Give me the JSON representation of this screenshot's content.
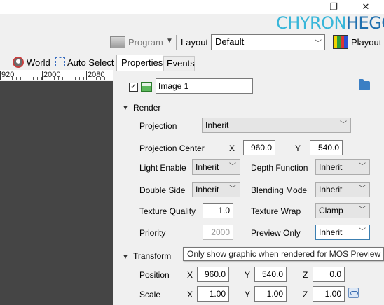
{
  "window": {
    "minimize_glyph": "—",
    "restore_glyph": "❐",
    "close_glyph": "✕",
    "logo_part1": "CHYRON",
    "logo_part2": "HEGO"
  },
  "toolbar": {
    "program_label": "Program",
    "layout_label": "Layout",
    "layout_value": "Default",
    "playout_label": "Playout"
  },
  "left_panel": {
    "world_label": "World",
    "auto_select_label": "Auto Select",
    "ruler_labels": [
      "920",
      "2000",
      "2080"
    ]
  },
  "tabs": {
    "properties": "Properties",
    "events": "Events"
  },
  "object": {
    "checked": "✓",
    "name": "Image 1"
  },
  "render": {
    "title": "Render",
    "projection_label": "Projection",
    "projection_value": "Inherit",
    "projection_center_label": "Projection Center",
    "x_label": "X",
    "x_value": "960.0",
    "y_label": "Y",
    "y_value": "540.0",
    "light_enable_label": "Light Enable",
    "light_enable_value": "Inherit",
    "depth_function_label": "Depth Function",
    "depth_function_value": "Inherit",
    "double_side_label": "Double Side",
    "double_side_value": "Inherit",
    "blending_mode_label": "Blending Mode",
    "blending_mode_value": "Inherit",
    "texture_quality_label": "Texture Quality",
    "texture_quality_value": "1.0",
    "texture_wrap_label": "Texture Wrap",
    "texture_wrap_value": "Clamp",
    "priority_label": "Priority",
    "priority_value": "2000",
    "preview_only_label": "Preview Only",
    "preview_only_value": "Inherit"
  },
  "tooltip": "Only show graphic when rendered for MOS Preview",
  "transform": {
    "title": "Transform",
    "position_label": "Position",
    "scale_label": "Scale",
    "x_label": "X",
    "y_label": "Y",
    "z_label": "Z",
    "position_x": "960.0",
    "position_y": "540.0",
    "position_z": "0.0",
    "scale_x": "1.00",
    "scale_y": "1.00",
    "scale_z": "1.00"
  },
  "colors": {
    "canvas": "#454545",
    "logo_light": "#38b6d9",
    "logo_dark": "#1f6fae",
    "focus_border": "#3c7fb1"
  }
}
